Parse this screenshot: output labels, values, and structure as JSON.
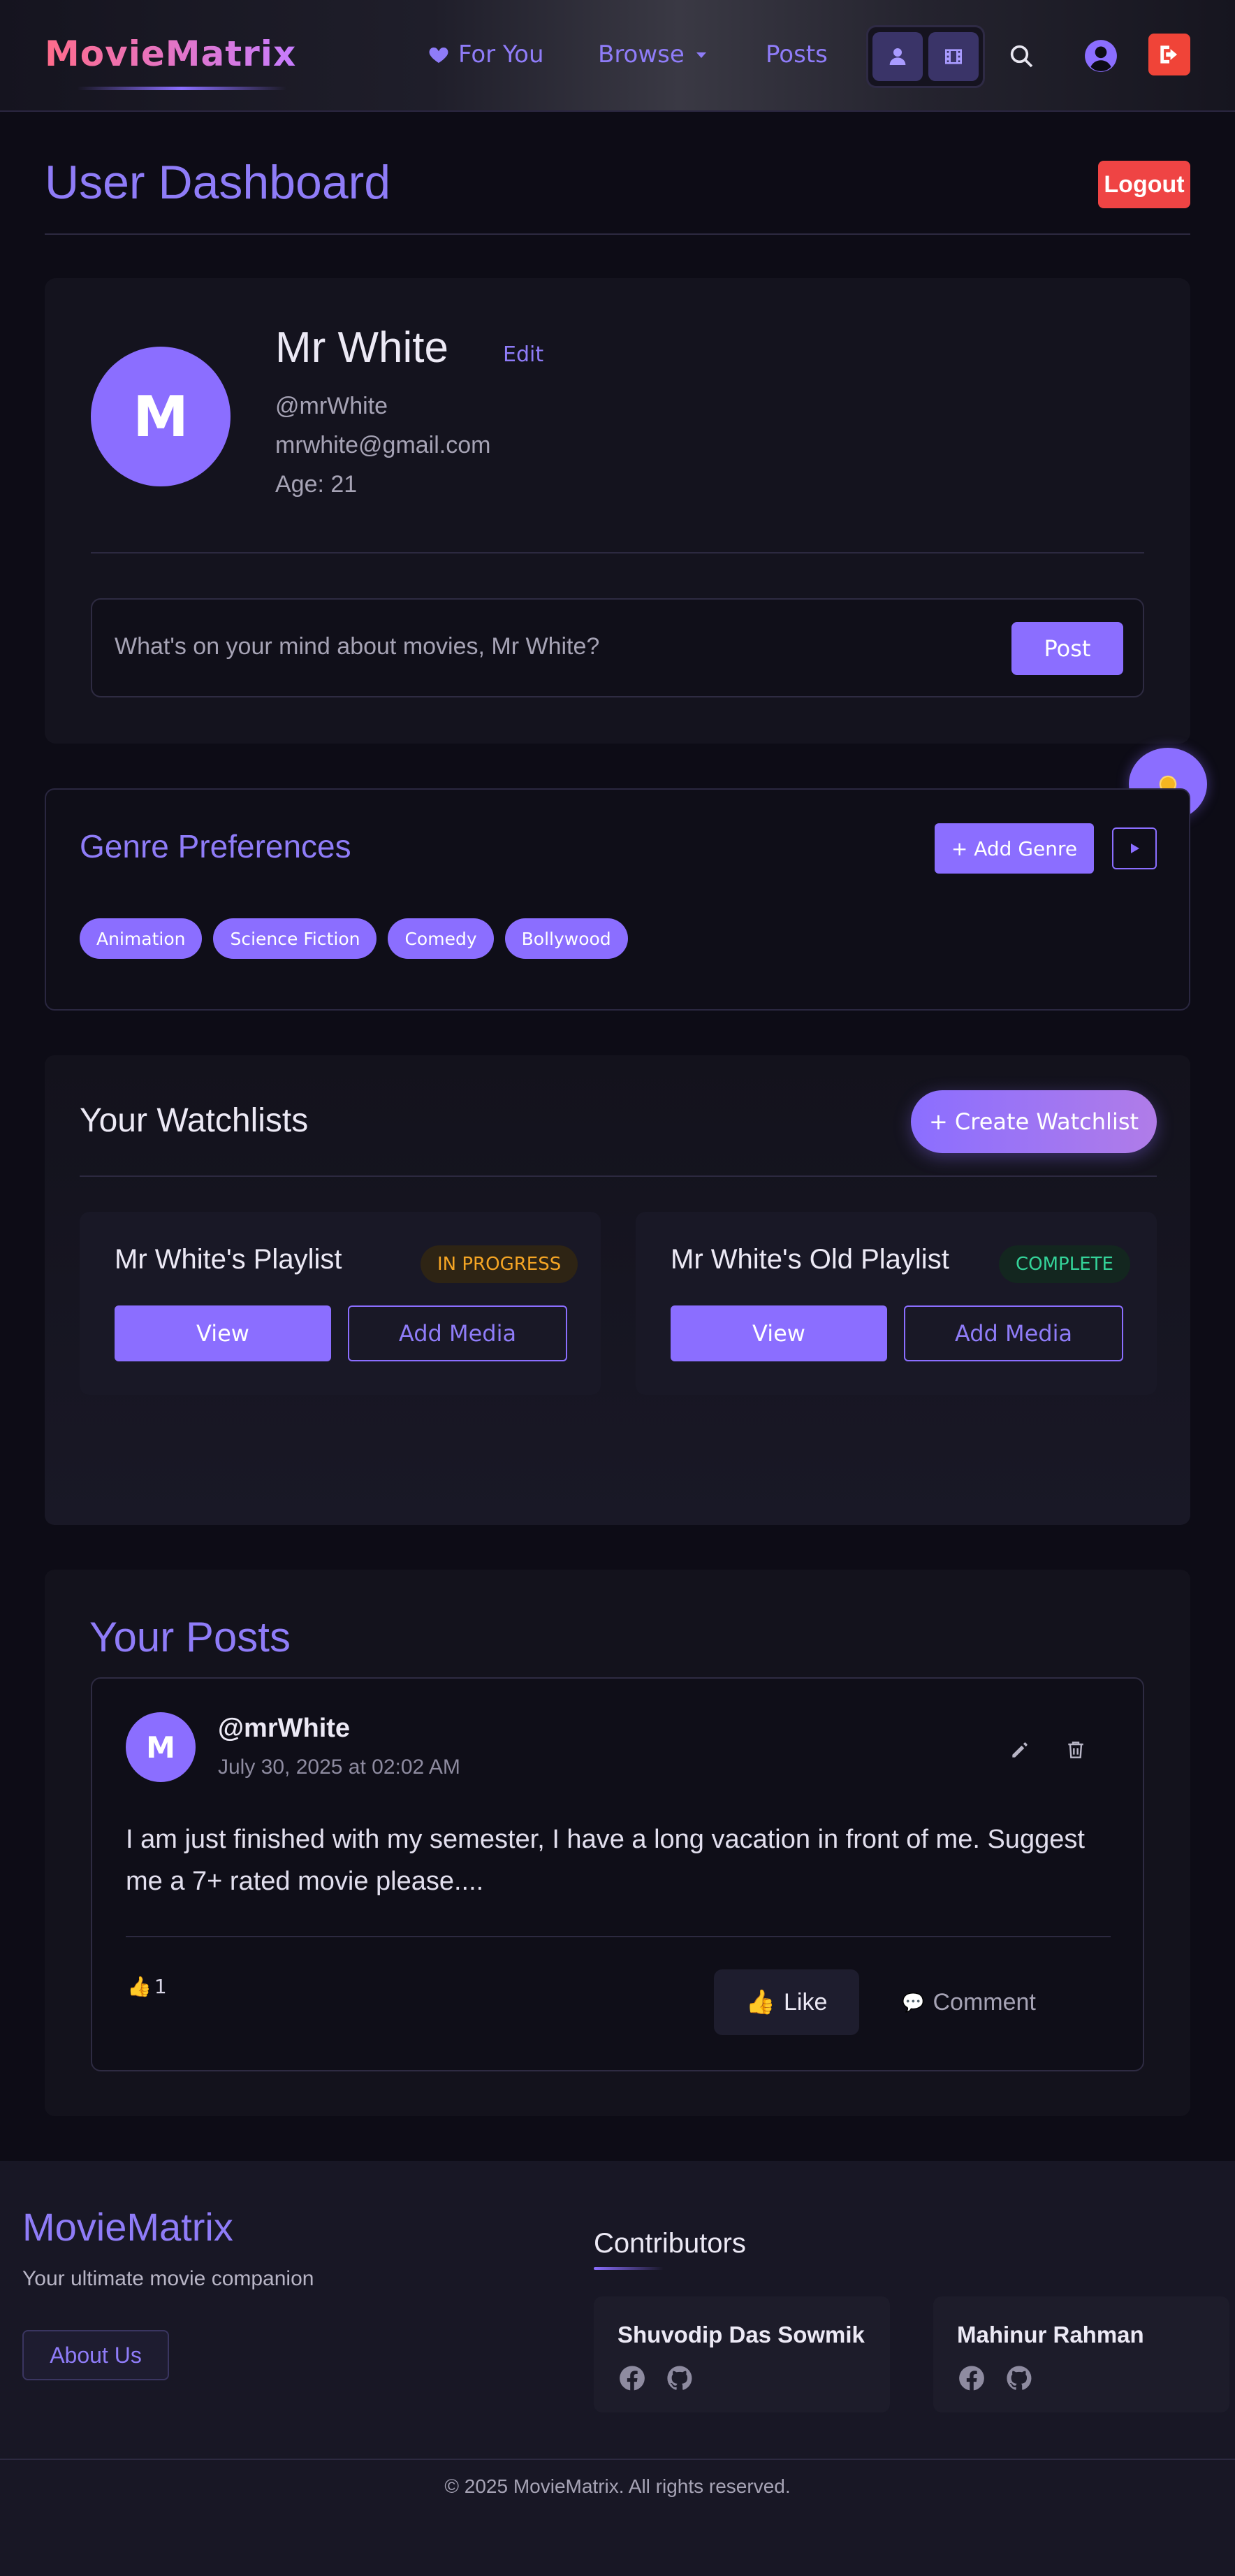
{
  "app": {
    "brand": "MovieMatrix"
  },
  "nav": {
    "for_you": "For You",
    "browse": "Browse",
    "posts": "Posts"
  },
  "header": {
    "title": "User Dashboard",
    "logout": "Logout"
  },
  "profile": {
    "avatar_letter": "M",
    "name": "Mr White",
    "edit": "Edit",
    "username": "@mrWhite",
    "email": "mrwhite@gmail.com",
    "age": "Age: 21",
    "composer_placeholder": "What's on your mind about movies, Mr White?",
    "post_button": "Post"
  },
  "genres": {
    "title": "Genre Preferences",
    "add_button": "+ Add Genre",
    "items": [
      "Animation",
      "Science Fiction",
      "Comedy",
      "Bollywood"
    ]
  },
  "watchlists": {
    "title": "Your Watchlists",
    "create_button": "+ Create Watchlist",
    "items": [
      {
        "name": "Mr White's Playlist",
        "status": "IN PROGRESS",
        "view": "View",
        "add": "Add Media"
      },
      {
        "name": "Mr White's Old Playlist",
        "status": "COMPLETE",
        "view": "View",
        "add": "Add Media"
      }
    ]
  },
  "posts": {
    "title": "Your Posts",
    "items": [
      {
        "avatar_letter": "M",
        "user": "@mrWhite",
        "date": "July 30, 2025 at 02:02 AM",
        "body": "I am just finished with my semester, I have a long vacation in front of me. Suggest me a 7+ rated movie please....",
        "likes": "1",
        "like_label": "Like",
        "comment_label": "Comment"
      }
    ]
  },
  "footer": {
    "brand": "MovieMatrix",
    "tagline": "Your ultimate movie companion",
    "about": "About Us",
    "contributors_title": "Contributors",
    "contributors": [
      "Shuvodip Das Sowmik",
      "Mahinur Rahman"
    ],
    "copyright": "© 2025 MovieMatrix. All rights reserved."
  },
  "colors": {
    "accent": "#8b6eff",
    "danger": "#ef4444",
    "in_progress": "#f5a524",
    "complete": "#34d399"
  },
  "icons": [
    "heart-icon",
    "chevron-down-icon",
    "user-icon",
    "film-icon",
    "search-icon",
    "user-circle-icon",
    "sign-out-icon",
    "sun-icon",
    "play-icon",
    "pencil-icon",
    "trash-icon",
    "thumbs-up-icon",
    "comment-icon",
    "facebook-icon",
    "github-icon"
  ]
}
